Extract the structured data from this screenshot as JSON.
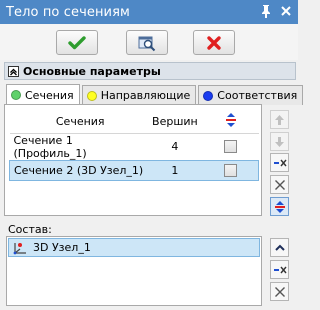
{
  "window": {
    "title": "Тело по сечениям",
    "pin_icon": "pin-icon",
    "close_icon": "close-icon"
  },
  "toolbar": {
    "ok_icon": "check-icon",
    "preview_icon": "preview-icon",
    "cancel_icon": "cross-icon"
  },
  "section": {
    "title": "Основные параметры"
  },
  "tabs": [
    {
      "label": "Сечения",
      "color": "#5fd16a",
      "active": true
    },
    {
      "label": "Направляющие",
      "color": "#ffff22",
      "active": false
    },
    {
      "label": "Соответствия",
      "color": "#1a3cf0",
      "active": false
    }
  ],
  "grid": {
    "headers": {
      "name": "Сечения",
      "count": "Вершин"
    },
    "rows": [
      {
        "name": "Сечение 1 (Профиль_1)",
        "count": "4",
        "checked": false,
        "selected": false
      },
      {
        "name": "Сечение 2 (3D Узел_1)",
        "count": "1",
        "checked": false,
        "selected": true
      }
    ]
  },
  "composition": {
    "label": "Состав:",
    "items": [
      {
        "label": "3D Узел_1",
        "icon": "node-3d-icon"
      }
    ]
  },
  "colors": {
    "titlebar": "#4e88c6",
    "ok_green": "#2e9d2e",
    "cancel_red": "#e02020",
    "selection": "#cde6f7",
    "accent_blue": "#1f4fd0"
  }
}
